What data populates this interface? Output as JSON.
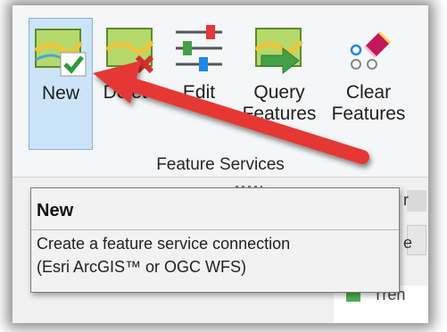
{
  "ribbon": {
    "buttons": [
      {
        "label_1": "New",
        "label_2": ""
      },
      {
        "label_1": "Delete",
        "label_2": ""
      },
      {
        "label_1": "Edit",
        "label_2": ""
      },
      {
        "label_1": "Query",
        "label_2": "Features"
      },
      {
        "label_1": "Clear",
        "label_2": "Features"
      }
    ],
    "group_label": "Feature Services"
  },
  "tooltip": {
    "title": "New",
    "description_line_1": "Create a feature service connection",
    "description_line_2": "(Esri ArcGIS™ or OGC WFS)"
  },
  "background": {
    "right_text_1": "r",
    "right_text_2": "e",
    "bottom_text": "Tren"
  },
  "colors": {
    "arrow": "#e53935",
    "selected_button_bg": "#cce4f7",
    "selected_button_border": "#7fb4e2"
  },
  "icons": {
    "new": "map-check-icon",
    "delete": "map-delete-icon",
    "edit": "sliders-icon",
    "query": "map-arrow-icon",
    "clear": "eraser-icon"
  }
}
